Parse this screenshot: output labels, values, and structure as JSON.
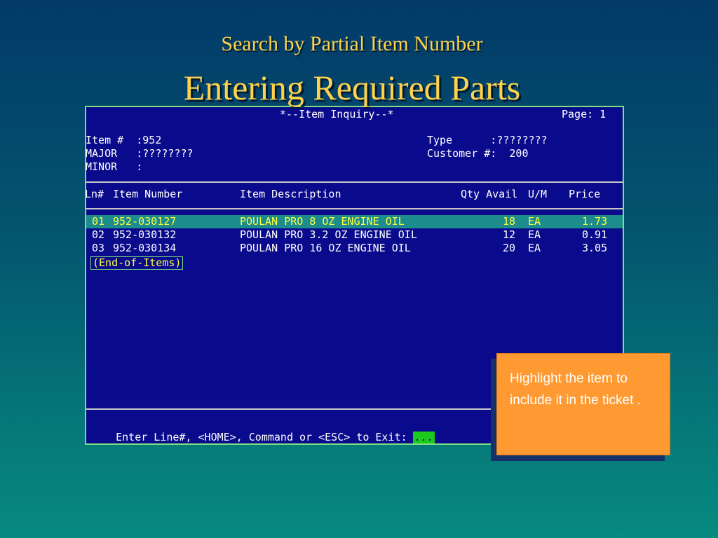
{
  "slide": {
    "subtitle": "Search by Partial Item Number",
    "title": "Entering Required Parts"
  },
  "terminal": {
    "header_title": "*--Item Inquiry--*",
    "page_label": "Page: 1",
    "fields": {
      "item_label": "Item #  :952",
      "major_label": "MAJOR   :????????",
      "minor_label": "MINOR   :",
      "type_label": "Type      :????????",
      "customer_label": "Customer #:  200"
    },
    "columns": {
      "ln": "Ln#",
      "item_number": "Item Number",
      "item_description": "Item Description",
      "qty_avail": "Qty Avail",
      "um": "U/M",
      "price": "Price"
    },
    "items": [
      {
        "ln": "01",
        "number": "952-030127",
        "description": "POULAN PRO 8 OZ ENGINE OIL",
        "qty": "18",
        "um": "EA",
        "price": "1.73"
      },
      {
        "ln": "02",
        "number": "952-030132",
        "description": "POULAN PRO 3.2 OZ ENGINE OIL",
        "qty": "12",
        "um": "EA",
        "price": "0.91"
      },
      {
        "ln": "03",
        "number": "952-030134",
        "description": "POULAN PRO 16 OZ ENGINE OIL",
        "qty": "20",
        "um": "EA",
        "price": "3.05"
      }
    ],
    "end_marker": "(End-of-Items)",
    "prompt": "Enter Line#, <HOME>, Command or <ESC> to Exit:",
    "prompt_value": "...",
    "colors": {
      "screen_bg": "#0a0a8c",
      "selected_bg": "#1c8c8c",
      "selected_text": "#ffff40",
      "border": "#7ee07e"
    }
  },
  "callout": {
    "text": "Highlight the item to include it in the ticket .",
    "color": "#ff9a33"
  }
}
